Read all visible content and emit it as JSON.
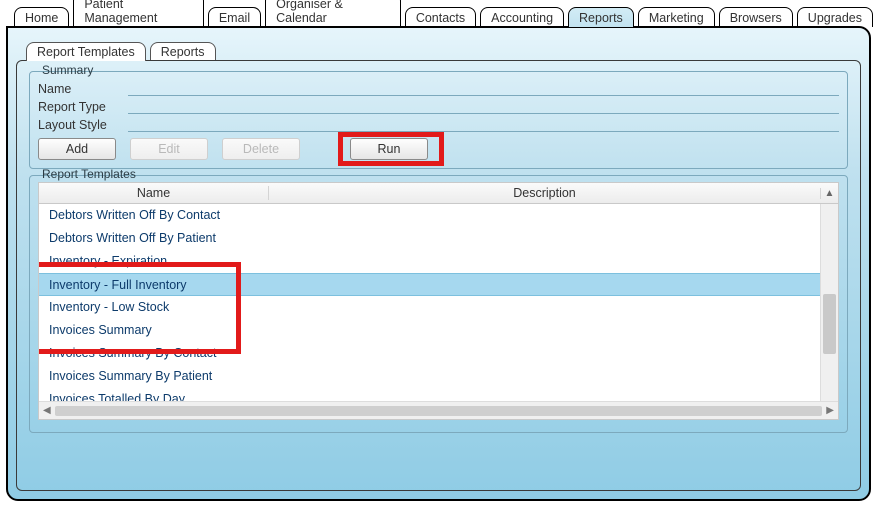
{
  "top_tabs": [
    {
      "label": "Home"
    },
    {
      "label": "Patient Management"
    },
    {
      "label": "Email"
    },
    {
      "label": "Organiser & Calendar"
    },
    {
      "label": "Contacts"
    },
    {
      "label": "Accounting"
    },
    {
      "label": "Reports",
      "active": true
    },
    {
      "label": "Marketing"
    },
    {
      "label": "Browsers"
    },
    {
      "label": "Upgrades"
    }
  ],
  "inner_tabs": [
    {
      "label": "Report Templates",
      "active": true
    },
    {
      "label": "Reports"
    }
  ],
  "summary": {
    "legend": "Summary",
    "name_label": "Name",
    "type_label": "Report Type",
    "layout_label": "Layout Style"
  },
  "buttons": {
    "add": "Add",
    "edit": "Edit",
    "delete": "Delete",
    "run": "Run"
  },
  "templates_legend": "Report Templates",
  "table": {
    "col_name": "Name",
    "col_desc": "Description",
    "rows": [
      {
        "name": "Debtors Written Off By Contact"
      },
      {
        "name": "Debtors Written Off By Patient"
      },
      {
        "name": "Inventory - Expiration"
      },
      {
        "name": "Inventory - Full Inventory",
        "selected": true
      },
      {
        "name": "Inventory - Low Stock"
      },
      {
        "name": "Invoices Summary"
      },
      {
        "name": "Invoices Summary By Contact"
      },
      {
        "name": "Invoices Summary By Patient"
      },
      {
        "name": "Invoices Totalled By Day"
      }
    ]
  }
}
